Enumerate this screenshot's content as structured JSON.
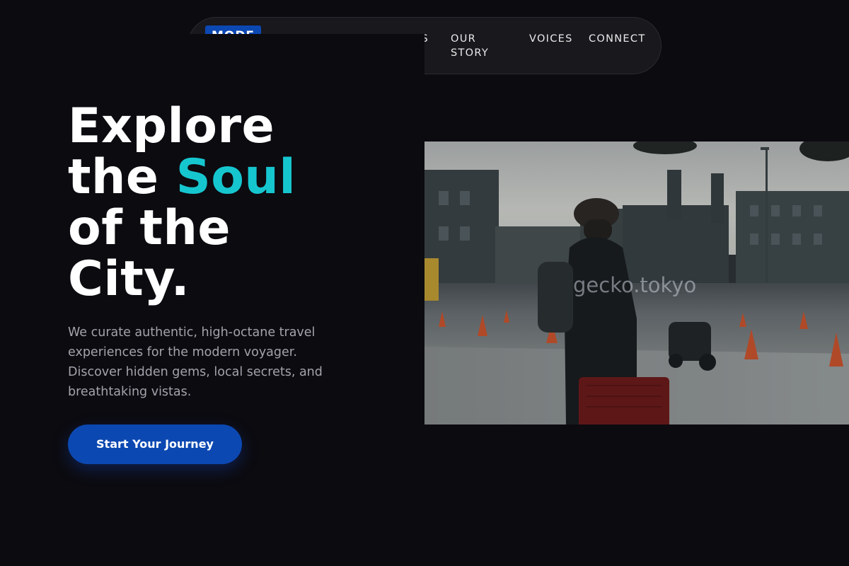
{
  "nav": {
    "logo_text": "MODE",
    "links": [
      {
        "label": "DESTINATIONS"
      },
      {
        "label": "OUR STORY"
      },
      {
        "label": "VOICES"
      },
      {
        "label": "CONNECT"
      }
    ]
  },
  "hero": {
    "title_line1": "Explore",
    "title_line2_pre": "the ",
    "title_line2_accent": "Soul",
    "title_line3": "of the",
    "title_line4": "City.",
    "description": "We curate authentic, high-octane travel experiences for the modern voyager. Discover hidden gems, local secrets, and breathtaking vistas.",
    "cta_label": "Start Your Journey"
  },
  "photo": {
    "watermark": "gecko.tokyo"
  },
  "colors": {
    "background": "#0c0b10",
    "accent_cyan": "#16c6cf",
    "brand_blue": "#0c48b2",
    "nav_bg": "#19181d"
  }
}
